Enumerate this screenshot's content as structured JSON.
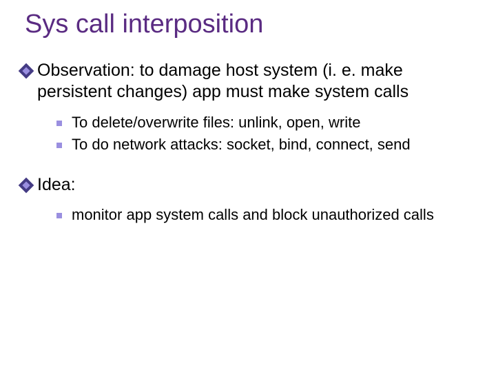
{
  "title": "Sys call interposition",
  "points": [
    {
      "text": "Observation:   to damage host system (i. e. make persistent changes)  app must make system calls",
      "sub": [
        "To delete/overwrite files:     unlink, open, write",
        "To do network attacks:    socket, bind, connect, send"
      ]
    },
    {
      "text": "Idea:",
      "sub": [
        "monitor app system calls and block unauthorized calls"
      ]
    }
  ]
}
